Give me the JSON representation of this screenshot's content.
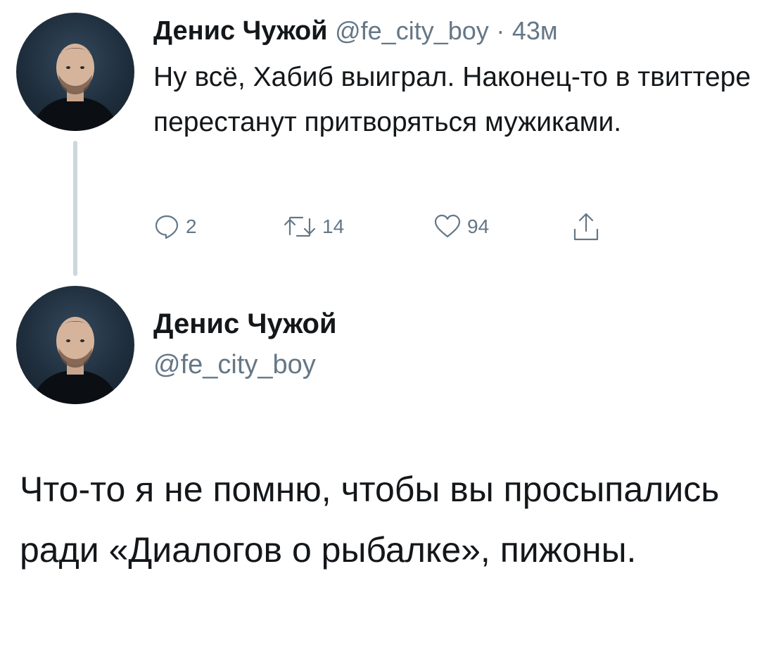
{
  "tweet1": {
    "author_name": "Денис Чужой",
    "author_handle": "@fe_city_boy",
    "separator": "·",
    "time": "43м",
    "text": "Ну всё, Хабиб выиграл. Наконец-то в твиттере перестанут притворяться мужиками.",
    "actions": {
      "reply_count": "2",
      "retweet_count": "14",
      "like_count": "94"
    },
    "icons": {
      "reply": "reply-icon",
      "retweet": "retweet-icon",
      "like": "heart-icon",
      "share": "share-icon"
    }
  },
  "tweet2": {
    "author_name": "Денис Чужой",
    "author_handle": "@fe_city_boy",
    "text": "Что-то я не помню, чтобы вы просыпались ради «Диалогов о рыбалке», пижоны."
  },
  "colors": {
    "text_primary": "#14171a",
    "text_secondary": "#657786",
    "thread_line": "#ccd6dd",
    "background": "#ffffff"
  }
}
